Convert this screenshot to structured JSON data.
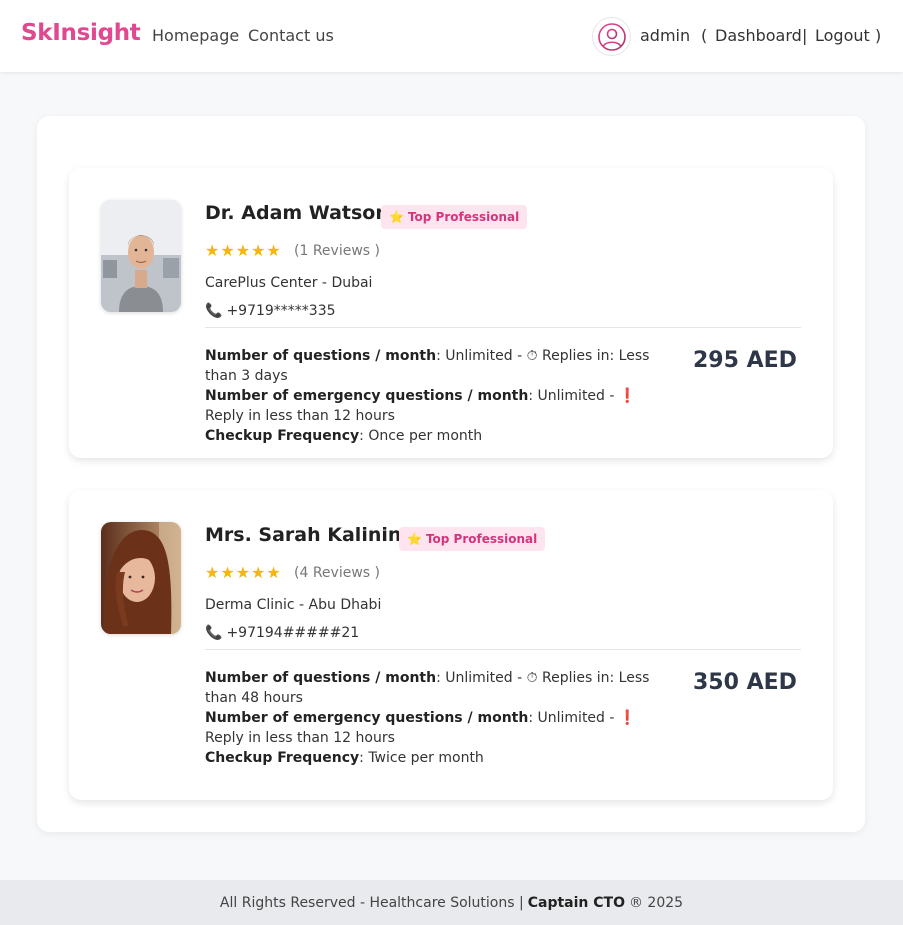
{
  "header": {
    "logo": "SkInsight",
    "nav": [
      "Homepage",
      "Contact us"
    ],
    "user_name": "admin",
    "paren_open": "(",
    "paren_close": ")",
    "separator": "|",
    "dashboard": "Dashboard",
    "logout": "Logout"
  },
  "doctors": [
    {
      "name": "Dr. Adam Watson",
      "badge": "Top Professional",
      "stars": "★★★★★",
      "reviews": "(1 Reviews )",
      "clinic": "CarePlus Center - Dubai",
      "phone": "+9719*****335",
      "questions_label": "Number of questions / month",
      "questions_text": ": Unlimited - ⏱ Replies in: Less than 3 days",
      "emergency_label": "Number of emergency questions / month",
      "emergency_text": ": Unlimited - ❗ Reply in less than 12 hours",
      "checkup_label": "Checkup Frequency",
      "checkup_text": ": Once per month",
      "price": "295 AED"
    },
    {
      "name": "Mrs. Sarah Kalinina",
      "badge": "Top Professional",
      "stars": "★★★★★",
      "reviews": "(4 Reviews )",
      "clinic": "Derma Clinic - Abu Dhabi",
      "phone": "+97194#####21",
      "questions_label": "Number of questions / month",
      "questions_text": ": Unlimited - ⏱ Replies in: Less than 48 hours",
      "emergency_label": "Number of emergency questions / month",
      "emergency_text": ": Unlimited - ❗ Reply in less than 12 hours",
      "checkup_label": "Checkup Frequency",
      "checkup_text": ": Twice per month",
      "price": "350 AED"
    }
  ],
  "footer": {
    "left": "All Rights Reserved - Healthcare Solutions |",
    "brand": "Captain CTO",
    "right": "® 2025"
  },
  "colors": {
    "brand": "#e0488f",
    "badge_bg": "#fde4ef",
    "badge_text": "#d6337c",
    "star": "#f5b50a"
  }
}
